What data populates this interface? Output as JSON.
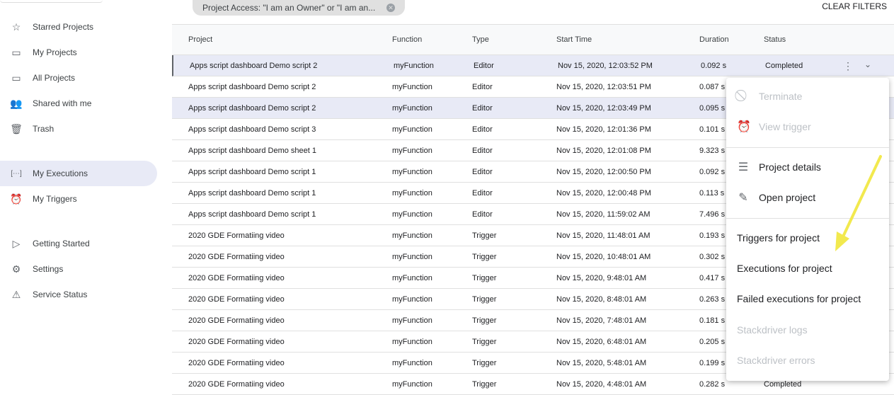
{
  "sidebar": {
    "items": [
      {
        "label": "Starred Projects",
        "icon": "star-icon"
      },
      {
        "label": "My Projects",
        "icon": "folder-icon"
      },
      {
        "label": "All Projects",
        "icon": "folder-icon"
      },
      {
        "label": "Shared with me",
        "icon": "people-icon"
      },
      {
        "label": "Trash",
        "icon": "trash-icon"
      },
      {
        "label": "My Executions",
        "icon": "executions-icon",
        "active": true
      },
      {
        "label": "My Triggers",
        "icon": "alarm-icon"
      },
      {
        "label": "Getting Started",
        "icon": "play-icon"
      },
      {
        "label": "Settings",
        "icon": "gear-icon"
      },
      {
        "label": "Service Status",
        "icon": "warning-icon"
      }
    ]
  },
  "filter": {
    "chip": "Project Access: \"I am an Owner\" or \"I am an...",
    "clear": "CLEAR FILTERS"
  },
  "table": {
    "headers": [
      "Project",
      "Function",
      "Type",
      "Start Time",
      "Duration",
      "Status"
    ],
    "rows": [
      [
        "Apps script dashboard Demo script 2",
        "myFunction",
        "Editor",
        "Nov 15, 2020, 12:03:52 PM",
        "0.092 s",
        "Completed"
      ],
      [
        "Apps script dashboard Demo script 2",
        "myFunction",
        "Editor",
        "Nov 15, 2020, 12:03:51 PM",
        "0.087 s",
        ""
      ],
      [
        "Apps script dashboard Demo script 2",
        "myFunction",
        "Editor",
        "Nov 15, 2020, 12:03:49 PM",
        "0.095 s",
        ""
      ],
      [
        "Apps script dashboard Demo script 3",
        "myFunction",
        "Editor",
        "Nov 15, 2020, 12:01:36 PM",
        "0.101 s",
        ""
      ],
      [
        "Apps script dashboard Demo sheet 1",
        "myFunction",
        "Editor",
        "Nov 15, 2020, 12:01:08 PM",
        "9.323 s",
        ""
      ],
      [
        "Apps script dashboard Demo script 1",
        "myFunction",
        "Editor",
        "Nov 15, 2020, 12:00:50 PM",
        "0.092 s",
        ""
      ],
      [
        "Apps script dashboard Demo script 1",
        "myFunction",
        "Editor",
        "Nov 15, 2020, 12:00:48 PM",
        "0.113 s",
        ""
      ],
      [
        "Apps script dashboard Demo script 1",
        "myFunction",
        "Editor",
        "Nov 15, 2020, 11:59:02 AM",
        "7.496 s",
        ""
      ],
      [
        "2020 GDE Formatiing video",
        "myFunction",
        "Trigger",
        "Nov 15, 2020, 11:48:01 AM",
        "0.193 s",
        ""
      ],
      [
        "2020 GDE Formatiing video",
        "myFunction",
        "Trigger",
        "Nov 15, 2020, 10:48:01 AM",
        "0.302 s",
        ""
      ],
      [
        "2020 GDE Formatiing video",
        "myFunction",
        "Trigger",
        "Nov 15, 2020, 9:48:01 AM",
        "0.417 s",
        ""
      ],
      [
        "2020 GDE Formatiing video",
        "myFunction",
        "Trigger",
        "Nov 15, 2020, 8:48:01 AM",
        "0.263 s",
        ""
      ],
      [
        "2020 GDE Formatiing video",
        "myFunction",
        "Trigger",
        "Nov 15, 2020, 7:48:01 AM",
        "0.181 s",
        ""
      ],
      [
        "2020 GDE Formatiing video",
        "myFunction",
        "Trigger",
        "Nov 15, 2020, 6:48:01 AM",
        "0.205 s",
        ""
      ],
      [
        "2020 GDE Formatiing video",
        "myFunction",
        "Trigger",
        "Nov 15, 2020, 5:48:01 AM",
        "0.199 s",
        ""
      ],
      [
        "2020 GDE Formatiing video",
        "myFunction",
        "Trigger",
        "Nov 15, 2020, 4:48:01 AM",
        "0.282 s",
        "Completed"
      ]
    ]
  },
  "menu": {
    "items": [
      {
        "label": "Terminate",
        "icon": "block-icon",
        "disabled": true
      },
      {
        "label": "View trigger",
        "icon": "alarm-icon",
        "disabled": true
      },
      {
        "label": "Project details",
        "icon": "list-icon",
        "disabled": false
      },
      {
        "label": "Open project",
        "icon": "pencil-icon",
        "disabled": false
      },
      {
        "label": "Triggers for project",
        "disabled": false
      },
      {
        "label": "Executions for project",
        "disabled": false
      },
      {
        "label": "Failed executions for project",
        "disabled": false
      },
      {
        "label": "Stackdriver logs",
        "disabled": true
      },
      {
        "label": "Stackdriver errors",
        "disabled": true
      }
    ]
  },
  "colors": {
    "arrow": "#f2e94e",
    "selected_row": "#e8eaf6"
  }
}
